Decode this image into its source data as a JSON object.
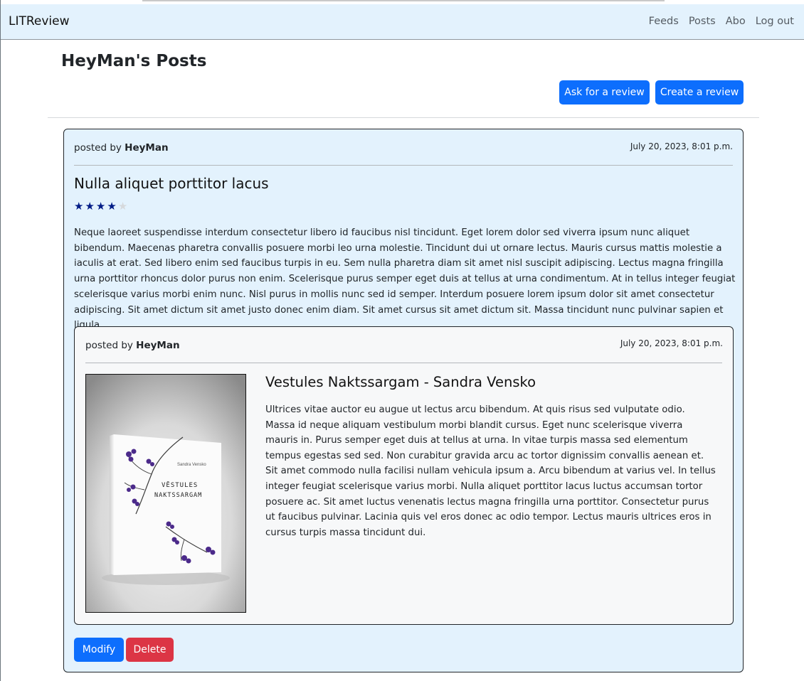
{
  "navbar": {
    "brand": "LITReview",
    "links": [
      "Feeds",
      "Posts",
      "Abo",
      "Log out"
    ]
  },
  "page": {
    "title": "HeyMan's Posts",
    "ask_button": "Ask for a review",
    "create_button": "Create a review"
  },
  "review": {
    "posted_by_prefix": "posted by ",
    "author": "HeyMan",
    "date": "July 20, 2023, 8:01 p.m.",
    "headline": "Nulla aliquet porttitor lacus",
    "rating": 4,
    "rating_max": 5,
    "body": "Neque laoreet suspendisse interdum consectetur libero id faucibus nisl tincidunt. Eget lorem dolor sed viverra ipsum nunc aliquet bibendum. Maecenas pharetra convallis posuere morbi leo urna molestie. Tincidunt dui ut ornare lectus. Mauris cursus mattis molestie a iaculis at erat. Sed libero enim sed faucibus turpis in eu. Sem nulla pharetra diam sit amet nisl suscipit adipiscing. Lectus magna fringilla urna porttitor rhoncus dolor purus non enim. Scelerisque purus semper eget duis at tellus at urna condimentum. At in tellus integer feugiat scelerisque varius morbi enim nunc. Nisl purus in mollis nunc sed id semper. Interdum posuere lorem ipsum dolor sit amet consectetur adipiscing. Sit amet dictum sit amet justo donec enim diam. Sit amet cursus sit amet dictum sit. Massa tincidunt nunc pulvinar sapien et ligula.",
    "modify_button": "Modify",
    "delete_button": "Delete"
  },
  "ticket": {
    "posted_by_prefix": "posted by ",
    "author": "HeyMan",
    "date": "July 20, 2023, 8:01 p.m.",
    "title": "Vestules Naktssargam - Sandra Vensko",
    "description": "Ultrices vitae auctor eu augue ut lectus arcu bibendum. At quis risus sed vulputate odio. Massa id neque aliquam vestibulum morbi blandit cursus. Eget nunc scelerisque viverra mauris in. Purus semper eget duis at tellus at urna. In vitae turpis massa sed elementum tempus egestas sed sed. Non curabitur gravida arcu ac tortor dignissim convallis aenean et. Sit amet commodo nulla facilisi nullam vehicula ipsum a. Arcu bibendum at varius vel. In tellus integer feugiat scelerisque varius morbi. Nulla aliquet porttitor lacus luctus accumsan tortor posuere ac. Sit amet luctus venenatis lectus magna fringilla urna porttitor. Consectetur purus ut faucibus pulvinar. Lacinia quis vel eros donec ac odio tempor. Lectus mauris ultrices eros in cursus turpis massa tincidunt dui.",
    "cover": {
      "author_text": "Sandra Vensko",
      "title_line1": "VĒSTULES",
      "title_line2": "NAKTSSARGAM"
    }
  },
  "colors": {
    "navbar_bg": "#e3f2fd",
    "card_bg": "#e3f2fd",
    "ticket_bg": "#f7f8f9",
    "primary": "#0d6efd",
    "danger": "#dc3545",
    "star_filled": "#001b86",
    "star_empty": "#d6d9dc"
  }
}
